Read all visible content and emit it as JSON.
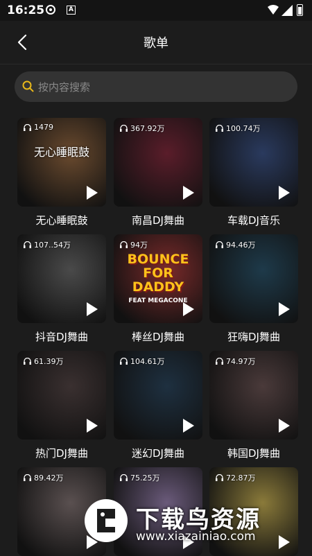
{
  "status_bar": {
    "time": "16:25",
    "a_label": "A"
  },
  "header": {
    "title": "歌单"
  },
  "search": {
    "placeholder": "按内容搜索"
  },
  "playlists": [
    {
      "name": "无心睡眠鼓",
      "plays": "1479",
      "inner_text": "无心睡眠鼓",
      "color": "#6a4a2e"
    },
    {
      "name": "南昌DJ舞曲",
      "plays": "367.92万",
      "color": "#5a1d2a"
    },
    {
      "name": "车载DJ音乐",
      "plays": "100.74万",
      "color": "#2a3a5e"
    },
    {
      "name": "抖音DJ舞曲",
      "plays": "107..54万",
      "color": "#4a4a4a"
    },
    {
      "name": "棒丝DJ舞曲",
      "plays": "94万",
      "cover_text": [
        "BOUNCE",
        "FOR DADDY"
      ],
      "cover_sub": "FEAT MEGACONE",
      "color": "#7a2a2a"
    },
    {
      "name": "狂嗨DJ舞曲",
      "plays": "94.46万",
      "color": "#1e3a4a"
    },
    {
      "name": "热门DJ舞曲",
      "plays": "61.39万",
      "color": "#3a3030"
    },
    {
      "name": "迷幻DJ舞曲",
      "plays": "104.61万",
      "color": "#1e3040"
    },
    {
      "name": "韩国DJ舞曲",
      "plays": "74.97万",
      "color": "#4a3a3a"
    },
    {
      "name": "",
      "plays": "89.42万",
      "color": "#5a5050"
    },
    {
      "name": "",
      "plays": "75.25万",
      "color": "#6a5a7a"
    },
    {
      "name": "",
      "plays": "72.87万",
      "color": "#8a7a3a"
    }
  ],
  "watermark": {
    "title": "下载鸟资源",
    "url": "www.xiazainiao.com"
  }
}
